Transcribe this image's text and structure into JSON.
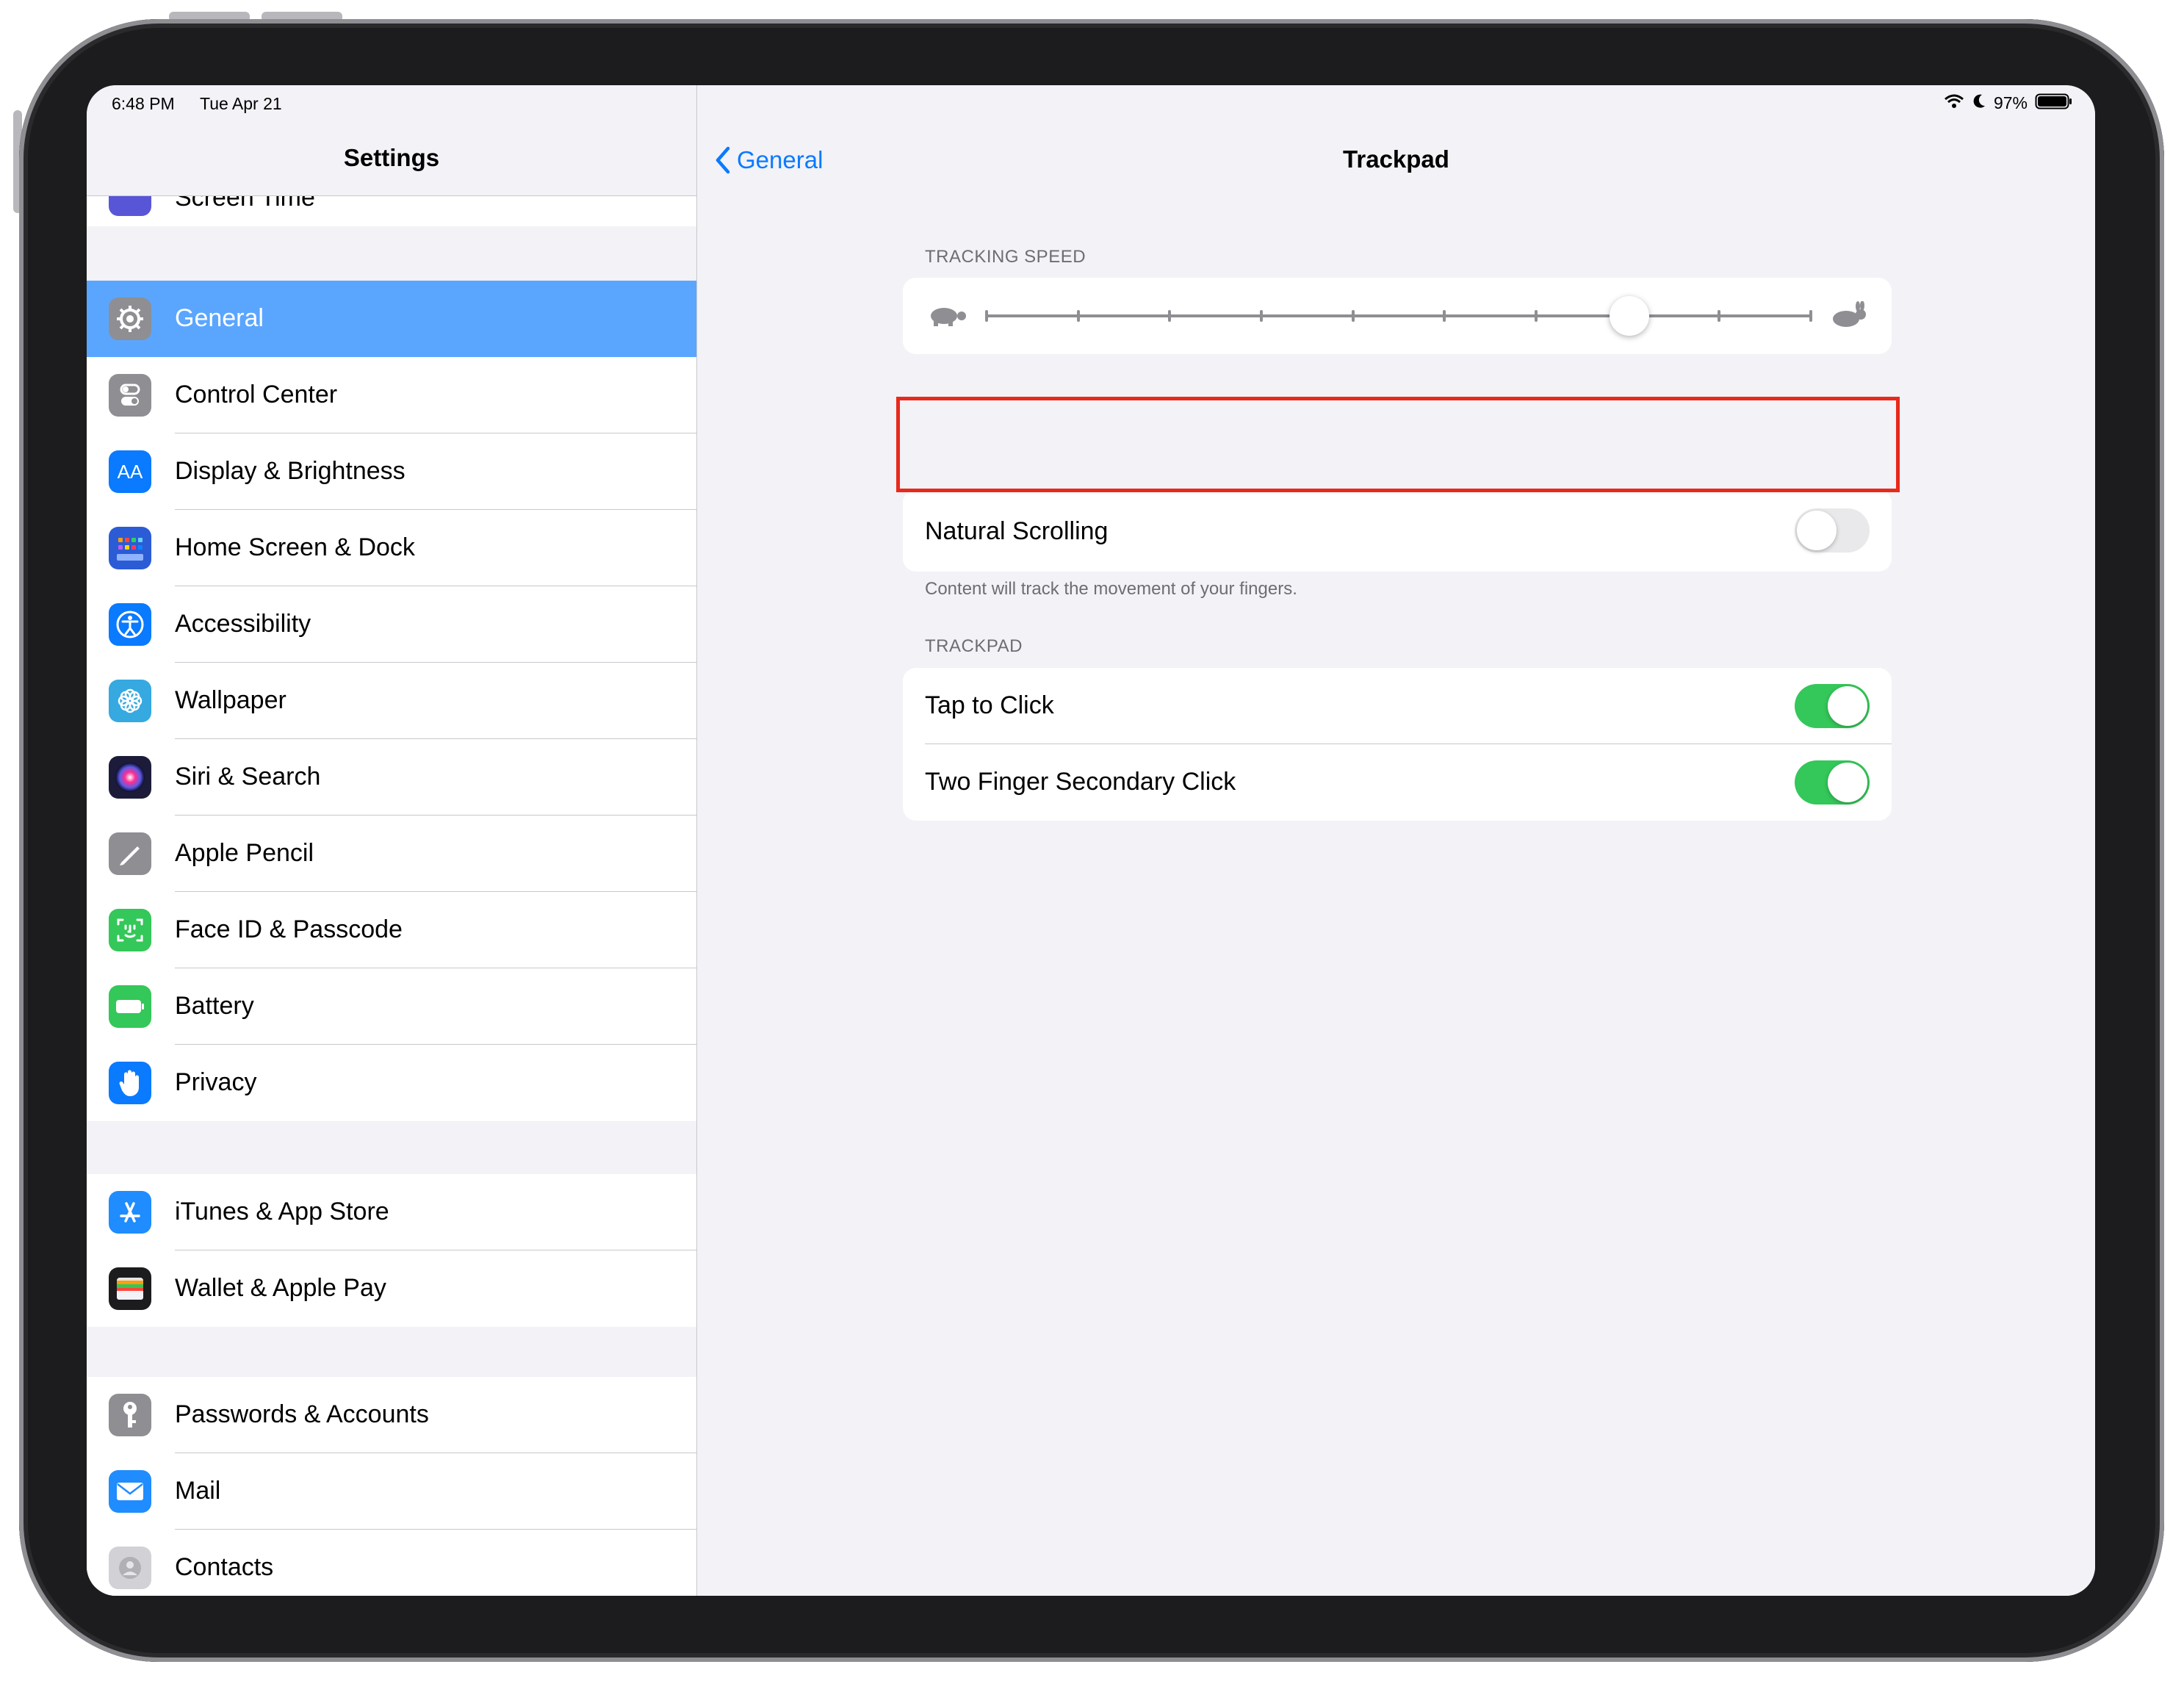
{
  "status_bar": {
    "time": "6:48 PM",
    "date": "Tue Apr 21",
    "battery": "97%"
  },
  "sidebar": {
    "title": "Settings",
    "partial_item": "Screen Time",
    "groups": [
      {
        "items": [
          {
            "label": "General",
            "icon": "gear-icon",
            "color": "#8e8e93",
            "selected": true
          },
          {
            "label": "Control Center",
            "icon": "switches-icon",
            "color": "#8e8e93"
          },
          {
            "label": "Display & Brightness",
            "icon": "text-size-icon",
            "color": "#0a7aff"
          },
          {
            "label": "Home Screen & Dock",
            "icon": "app-grid-icon",
            "color": "#2b5cd6"
          },
          {
            "label": "Accessibility",
            "icon": "accessibility-icon",
            "color": "#0a7aff"
          },
          {
            "label": "Wallpaper",
            "icon": "flower-icon",
            "color": "#35a9e0"
          },
          {
            "label": "Siri & Search",
            "icon": "siri-icon",
            "color": "#1c1c3a"
          },
          {
            "label": "Apple Pencil",
            "icon": "pencil-icon",
            "color": "#8e8e93"
          },
          {
            "label": "Face ID & Passcode",
            "icon": "face-id-icon",
            "color": "#34c759"
          },
          {
            "label": "Battery",
            "icon": "battery-icon",
            "color": "#34c759"
          },
          {
            "label": "Privacy",
            "icon": "hand-icon",
            "color": "#0a7aff"
          }
        ]
      },
      {
        "items": [
          {
            "label": "iTunes & App Store",
            "icon": "app-store-icon",
            "color": "#1f8cff"
          },
          {
            "label": "Wallet & Apple Pay",
            "icon": "wallet-icon",
            "color": "#1c1c1e"
          }
        ]
      },
      {
        "items": [
          {
            "label": "Passwords & Accounts",
            "icon": "key-icon",
            "color": "#8e8e93"
          },
          {
            "label": "Mail",
            "icon": "mail-icon",
            "color": "#1f8cff"
          },
          {
            "label": "Contacts",
            "icon": "contacts-icon",
            "color": "#b0b0b5"
          }
        ]
      }
    ]
  },
  "main": {
    "back_label": "General",
    "title": "Trackpad",
    "tracking_speed": {
      "header": "TRACKING SPEED",
      "value_fraction": 0.78,
      "ticks": 10
    },
    "natural_scrolling": {
      "label": "Natural Scrolling",
      "on": false,
      "footer": "Content will track the movement of your fingers."
    },
    "trackpad": {
      "header": "TRACKPAD",
      "items": [
        {
          "label": "Tap to Click",
          "on": true
        },
        {
          "label": "Two Finger Secondary Click",
          "on": true
        }
      ]
    },
    "highlight_color": "#e8291c"
  }
}
